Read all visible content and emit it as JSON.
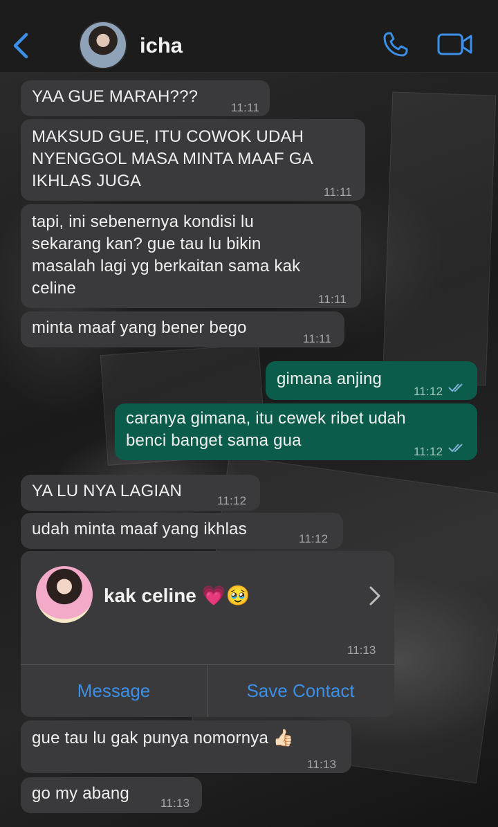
{
  "header": {
    "contact_name": "icha"
  },
  "messages": [
    {
      "dir": "in",
      "text_lines": [
        "YAA GUE MARAH???"
      ],
      "time": "11:11"
    },
    {
      "dir": "in",
      "text_lines": [
        "MAKSUD GUE, ITU COWOK UDAH",
        "NYENGGOL MASA MINTA MAAF GA",
        "IKHLAS JUGA"
      ],
      "time": "11:11"
    },
    {
      "dir": "in",
      "text_lines": [
        "tapi, ini sebenernya kondisi lu",
        "sekarang kan? gue tau lu bikin",
        "masalah lagi yg berkaitan sama kak",
        "celine"
      ],
      "time": "11:11"
    },
    {
      "dir": "in",
      "text_lines": [
        "minta maaf yang bener bego"
      ],
      "time": "11:11"
    },
    {
      "dir": "out",
      "text_lines": [
        "gimana anjing"
      ],
      "time": "11:12",
      "status": "read"
    },
    {
      "dir": "out",
      "text_lines": [
        "caranya gimana, itu cewek ribet udah",
        "benci banget sama gua"
      ],
      "time": "11:12",
      "status": "read"
    },
    {
      "dir": "in",
      "text_lines": [
        "YA LU NYA LAGIAN"
      ],
      "time": "11:12"
    },
    {
      "dir": "in",
      "text_lines": [
        "udah minta maaf yang ikhlas"
      ],
      "time": "11:12"
    },
    {
      "dir": "in",
      "text_lines": [
        "gue tau lu gak punya nomornya 👍🏻"
      ],
      "time": "11:13"
    },
    {
      "dir": "in",
      "text_lines": [
        "go my abang"
      ],
      "time": "11:13"
    }
  ],
  "contact_card": {
    "name": "kak celine 💗🥹",
    "time": "11:13",
    "buttons": {
      "message": "Message",
      "save_contact": "Save Contact"
    }
  },
  "colors": {
    "accent": "#3b8fe6",
    "incoming_bubble": "#3a3a3c",
    "outgoing_bubble": "#0b5c4a",
    "header_bg": "#1c1c1d"
  },
  "icons": {
    "back": "chevron-left-icon",
    "call": "phone-icon",
    "video": "video-camera-icon",
    "card_chevron": "chevron-right-icon",
    "read_status": "double-check-icon"
  }
}
